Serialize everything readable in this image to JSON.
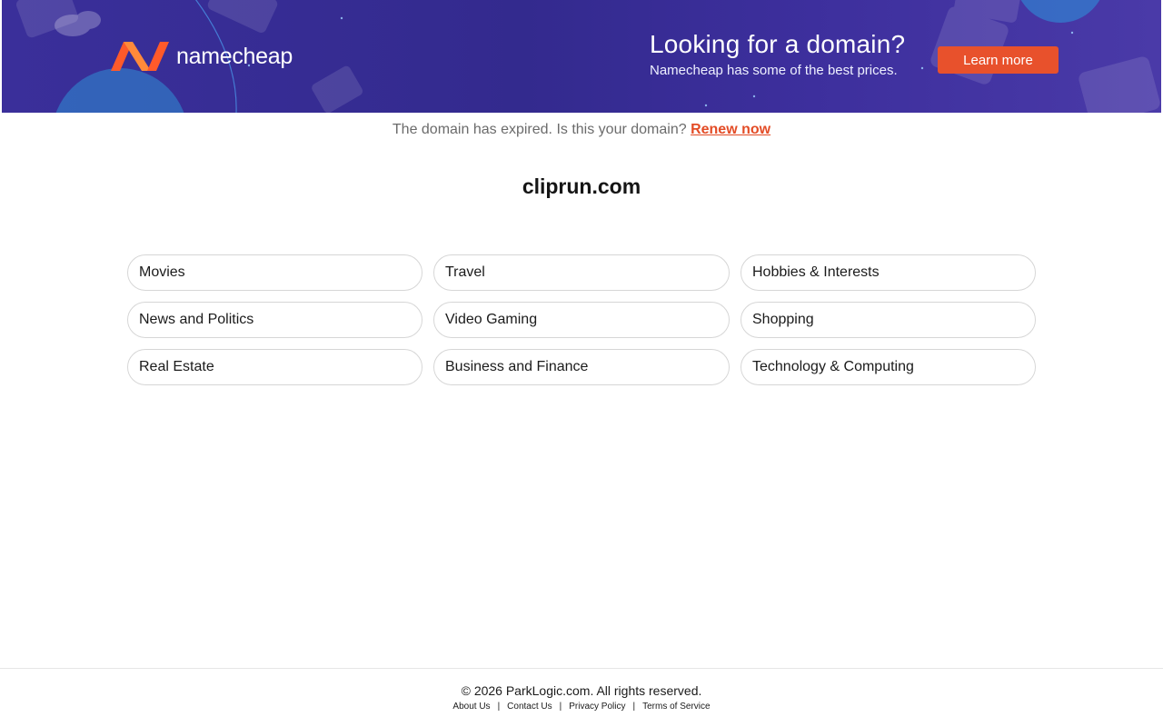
{
  "banner": {
    "logo_text": "namecheap",
    "logo_icon": "namecheap-n-logo",
    "promo_title": "Looking for a domain?",
    "promo_subtitle": "Namecheap has some of the best prices.",
    "cta_label": "Learn more",
    "colors": {
      "background": "#3a2f9a",
      "accent": "#e8512c",
      "logo_orange": "#ff6b2c"
    }
  },
  "notice": {
    "text": "The domain has expired. Is this your domain?",
    "link_label": "Renew now",
    "link_color": "#e34c26"
  },
  "domain": {
    "name": "cliprun.com"
  },
  "categories": [
    "Movies",
    "Travel",
    "Hobbies & Interests",
    "News and Politics",
    "Video Gaming",
    "Shopping",
    "Real Estate",
    "Business and Finance",
    "Technology & Computing"
  ],
  "footer": {
    "copyright": "© 2026 ParkLogic.com. All rights reserved.",
    "links": [
      "About Us",
      "Contact Us",
      "Privacy Policy",
      "Terms of Service"
    ],
    "separator": "|"
  }
}
